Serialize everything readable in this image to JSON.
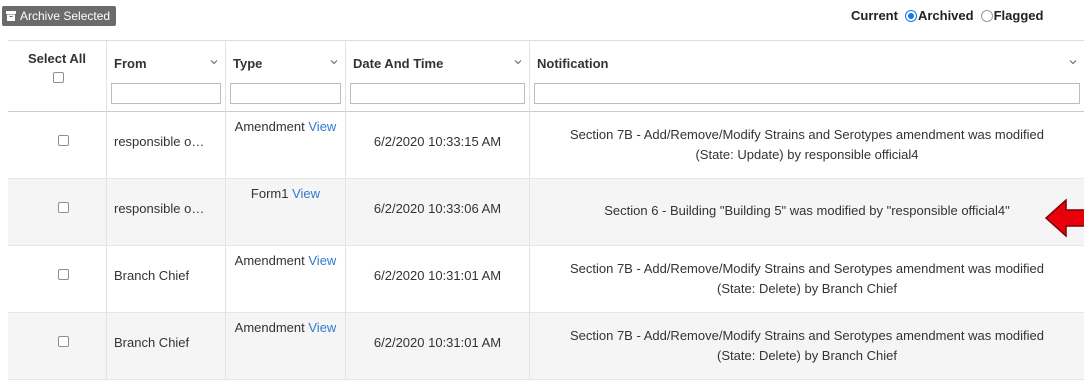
{
  "toolbar": {
    "archive_button_label": "Archive Selected",
    "archive_icon": "archive-icon"
  },
  "filters": {
    "options": [
      {
        "label": "Current",
        "selected": false
      },
      {
        "label": "Archived",
        "selected": true
      },
      {
        "label": "Flagged",
        "selected": false
      }
    ]
  },
  "grid": {
    "columns": {
      "select_all": "Select All",
      "from": "From",
      "type": "Type",
      "datetime": "Date And Time",
      "notification": "Notification"
    },
    "rows": [
      {
        "from": "responsible o…",
        "type": "Amendment",
        "view": "View",
        "datetime": "6/2/2020 10:33:15 AM",
        "notification": "Section 7B - Add/Remove/Modify Strains and Serotypes amendment was modified (State: Update) by responsible official4"
      },
      {
        "from": "responsible o…",
        "type": "Form1",
        "view": "View",
        "datetime": "6/2/2020 10:33:06 AM",
        "notification": "Section 6 - Building \"Building 5\" was modified by \"responsible official4\""
      },
      {
        "from": "Branch Chief",
        "type": "Amendment",
        "view": "View",
        "datetime": "6/2/2020 10:31:01 AM",
        "notification": "Section 7B - Add/Remove/Modify Strains and Serotypes amendment was modified (State: Delete) by Branch Chief"
      },
      {
        "from": "Branch Chief",
        "type": "Amendment",
        "view": "View",
        "datetime": "6/2/2020 10:31:01 AM",
        "notification": "Section 7B - Add/Remove/Modify Strains and Serotypes amendment was modified (State: Delete) by Branch Chief"
      }
    ]
  },
  "annotation": {
    "arrow_color": "#e8000b",
    "arrow_icon": "red-arrow-icon"
  },
  "colors": {
    "link": "#2e7bcf",
    "radio_accent": "#1a73e8",
    "button_bg": "#6b6b6b"
  }
}
